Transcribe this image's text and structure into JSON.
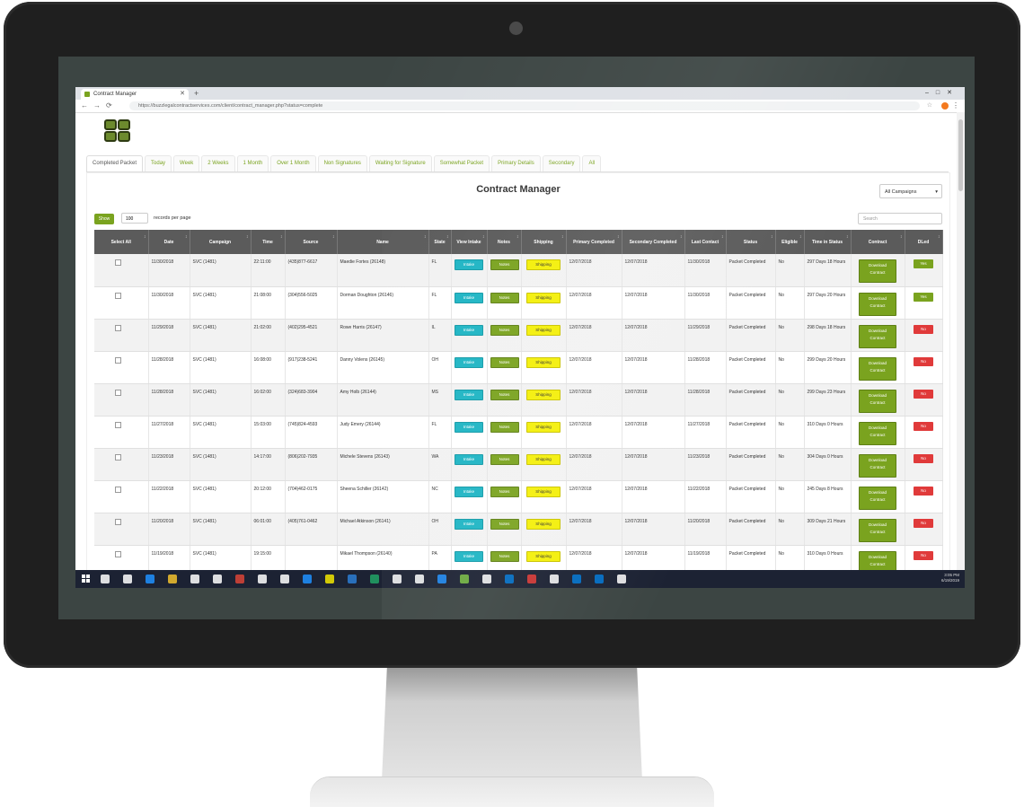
{
  "browser": {
    "tab_title": "Contract Manager",
    "url": "https://buzzlegalcontractservices.com/client/contract_manager.php?status=complete"
  },
  "page_tabs": [
    {
      "label": "Completed Packet",
      "active": true
    },
    {
      "label": "Today"
    },
    {
      "label": "Week"
    },
    {
      "label": "2 Weeks"
    },
    {
      "label": "1 Month"
    },
    {
      "label": "Over 1 Month"
    },
    {
      "label": "Non Signatures"
    },
    {
      "label": "Waiting for Signature"
    },
    {
      "label": "Somewhat Packet"
    },
    {
      "label": "Primary Details"
    },
    {
      "label": "Secondary"
    },
    {
      "label": "All"
    }
  ],
  "main": {
    "title": "Contract Manager",
    "campaign_filter": "All Campaigns",
    "show_button": "Show",
    "per_page_value": "100",
    "per_page_label": "records per page",
    "search_placeholder": "Search"
  },
  "table": {
    "headers": [
      "Select All",
      "Date",
      "Campaign",
      "Time",
      "Source",
      "Name",
      "State",
      "View Intake",
      "Notes",
      "Shipping",
      "Primary Completed",
      "Secondary Completed",
      "Last Contact",
      "Status",
      "Eligible",
      "Time in Status",
      "Contract",
      "DLed"
    ],
    "button_labels": {
      "intake": "Intake",
      "notes": "Notes",
      "shipping": "Shipping",
      "download": "Download Contract",
      "yes": "Yes",
      "no": "No"
    },
    "rows": [
      {
        "date": "11/30/2018",
        "campaign": "SVC (1481)",
        "time": "22:11:00",
        "source": "(435)877-6617",
        "name": "Maedie Fortes (26148)",
        "state": "FL",
        "primary": "12/07/2018",
        "secondary": "12/07/2018",
        "last": "11/30/2018",
        "status": "Packet Completed",
        "eligible": "No",
        "tis": "297 Days 18 Hours",
        "dled": "Yes"
      },
      {
        "date": "11/30/2018",
        "campaign": "SVC (1481)",
        "time": "21:08:00",
        "source": "(304)556-5025",
        "name": "Dorman Doughton (26146)",
        "state": "FL",
        "primary": "12/07/2018",
        "secondary": "12/07/2018",
        "last": "11/30/2018",
        "status": "Packet Completed",
        "eligible": "No",
        "tis": "297 Days 20 Hours",
        "dled": "Yes"
      },
      {
        "date": "11/29/2018",
        "campaign": "SVC (1481)",
        "time": "21:02:00",
        "source": "(402)295-4521",
        "name": "Rowe Harris (26147)",
        "state": "IL",
        "primary": "12/07/2018",
        "secondary": "12/07/2018",
        "last": "11/29/2018",
        "status": "Packet Completed",
        "eligible": "No",
        "tis": "298 Days 18 Hours",
        "dled": "No"
      },
      {
        "date": "11/28/2018",
        "campaign": "SVC (1481)",
        "time": "16:08:00",
        "source": "(917)238-5241",
        "name": "Danny Volens (26145)",
        "state": "OH",
        "primary": "12/07/2018",
        "secondary": "12/07/2018",
        "last": "11/28/2018",
        "status": "Packet Completed",
        "eligible": "No",
        "tis": "299 Days 20 Hours",
        "dled": "No"
      },
      {
        "date": "11/28/2018",
        "campaign": "SVC (1481)",
        "time": "16:02:00",
        "source": "(324)683-3904",
        "name": "Amy Holb (26144)",
        "state": "MS",
        "primary": "12/07/2018",
        "secondary": "12/07/2018",
        "last": "11/28/2018",
        "status": "Packet Completed",
        "eligible": "No",
        "tis": "299 Days 23 Hours",
        "dled": "No"
      },
      {
        "date": "11/27/2018",
        "campaign": "SVC (1481)",
        "time": "15:03:00",
        "source": "(745)824-4593",
        "name": "Judy Emery (26144)",
        "state": "FL",
        "primary": "12/07/2018",
        "secondary": "12/07/2018",
        "last": "11/27/2018",
        "status": "Packet Completed",
        "eligible": "No",
        "tis": "310 Days 0 Hours",
        "dled": "No"
      },
      {
        "date": "11/23/2018",
        "campaign": "SVC (1481)",
        "time": "14:17:00",
        "source": "(806)202-7935",
        "name": "Michele Stevens (26143)",
        "state": "WA",
        "primary": "12/07/2018",
        "secondary": "12/07/2018",
        "last": "11/23/2018",
        "status": "Packet Completed",
        "eligible": "No",
        "tis": "304 Days 0 Hours",
        "dled": "No"
      },
      {
        "date": "11/22/2018",
        "campaign": "SVC (1481)",
        "time": "20:12:00",
        "source": "(704)462-0175",
        "name": "Sheena Schiller (26142)",
        "state": "NC",
        "primary": "12/07/2018",
        "secondary": "12/07/2018",
        "last": "11/22/2018",
        "status": "Packet Completed",
        "eligible": "No",
        "tis": "245 Days 8 Hours",
        "dled": "No"
      },
      {
        "date": "11/20/2018",
        "campaign": "SVC (1481)",
        "time": "06:01:00",
        "source": "(405)761-0462",
        "name": "Michael Atkinson (26141)",
        "state": "OH",
        "primary": "12/07/2018",
        "secondary": "12/07/2018",
        "last": "11/20/2018",
        "status": "Packet Completed",
        "eligible": "No",
        "tis": "309 Days 21 Hours",
        "dled": "No"
      },
      {
        "date": "11/19/2018",
        "campaign": "SVC (1481)",
        "time": "19:15:00",
        "source": "",
        "name": "Mikael Thompson (26140)",
        "state": "PA",
        "primary": "12/07/2018",
        "secondary": "12/07/2018",
        "last": "11/19/2018",
        "status": "Packet Completed",
        "eligible": "No",
        "tis": "310 Days 0 Hours",
        "dled": "No"
      }
    ]
  },
  "taskbar": {
    "clock_time": "3:05 PM",
    "clock_date": "6/19/2019",
    "icon_colors": [
      "#ffffff",
      "#ffffff",
      "#1e90ff",
      "#f2c12e",
      "#ffffff",
      "#ffffff",
      "#db4437",
      "#ffffff",
      "#ffffff",
      "#1e90ff",
      "#f2e600",
      "#2b7cd3",
      "#21a366",
      "#ffffff",
      "#ffffff",
      "#1e90ff",
      "#7ac143",
      "#ffffff",
      "#0078d7",
      "#e53935",
      "#ffffff",
      "#0078d7",
      "#0078d7",
      "#ffffff"
    ]
  }
}
